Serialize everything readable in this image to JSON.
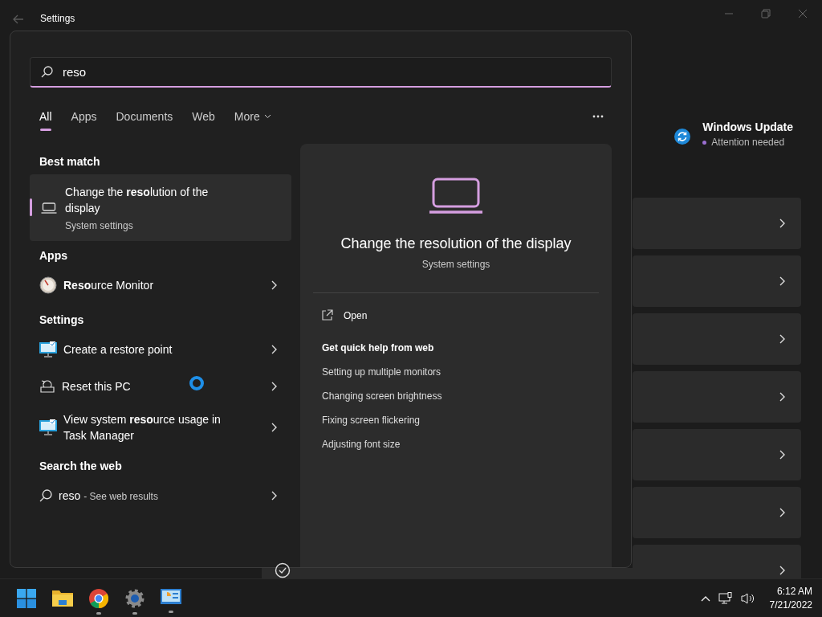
{
  "window": {
    "title": "Settings"
  },
  "update": {
    "title": "Windows Update",
    "status": "Attention needed"
  },
  "search": {
    "value": "reso"
  },
  "tabs": [
    {
      "label": "All",
      "selected": true,
      "kind": "tab"
    },
    {
      "label": "Apps",
      "selected": false,
      "kind": "tab"
    },
    {
      "label": "Documents",
      "selected": false,
      "kind": "tab"
    },
    {
      "label": "Web",
      "selected": false,
      "kind": "tab"
    },
    {
      "label": "More",
      "selected": false,
      "kind": "dropdown"
    }
  ],
  "best_match": {
    "heading": "Best match",
    "title": "Change the **reso**lution of the display",
    "subtitle": "System settings",
    "selected": true
  },
  "groups": [
    {
      "heading": "Apps",
      "items": [
        {
          "title": "**Reso**urce Monitor",
          "kind": "gauge"
        }
      ]
    },
    {
      "heading": "Settings",
      "items": [
        {
          "title": "Create a restore point",
          "kind": "monitor"
        },
        {
          "title": "Reset this PC",
          "kind": "reset"
        },
        {
          "title": "View system **reso**urce usage in Task Manager",
          "kind": "monitor"
        }
      ]
    },
    {
      "heading": "Search the web",
      "items": [
        {
          "title": "reso",
          "suffix": "- See web results",
          "kind": "web"
        }
      ]
    }
  ],
  "preview": {
    "title": "Change the resolution of the display",
    "subtitle": "System settings",
    "action": "Open",
    "help_heading": "Get quick help from web",
    "help_links": [
      "Setting up multiple monitors",
      "Changing screen brightness",
      "Fixing screen flickering",
      "Adjusting font size"
    ]
  },
  "taskbar": {
    "apps": [
      {
        "kind": "start",
        "running": false
      },
      {
        "kind": "folder",
        "running": false
      },
      {
        "kind": "browser",
        "running": true
      },
      {
        "kind": "settings",
        "running": true
      },
      {
        "kind": "control",
        "running": true
      }
    ],
    "time": "6:12 AM",
    "date": "7/21/2022"
  }
}
